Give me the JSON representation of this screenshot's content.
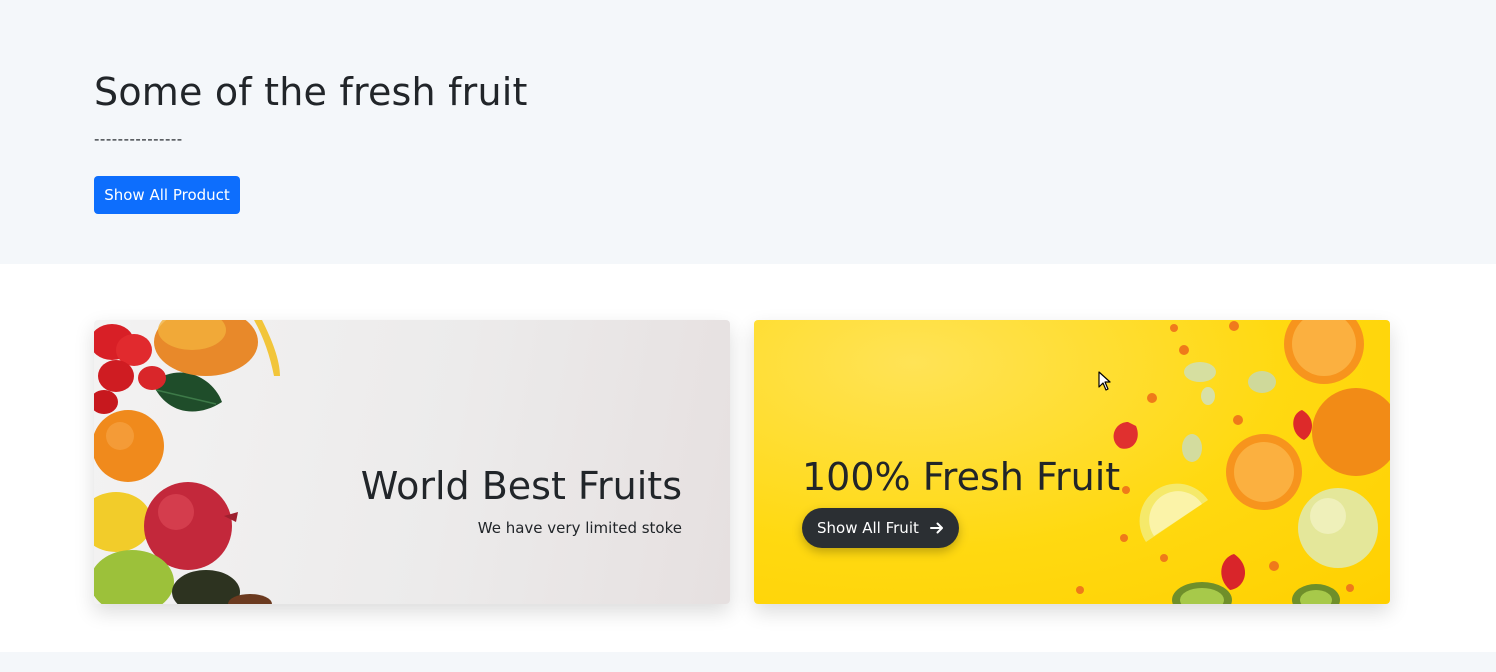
{
  "hero": {
    "title": "Some of the fresh fruit",
    "divider": "---------------",
    "button_label": "Show All Product"
  },
  "cards": {
    "left": {
      "title": "World Best Fruits",
      "subtitle": "We have very limited stoke"
    },
    "right": {
      "title": "100% Fresh Fruit",
      "button_label": "Show All Fruit",
      "button_icon": "arrow-right-icon"
    }
  },
  "colors": {
    "primary": "#0d6efd",
    "dark_button": "#2b2f33",
    "hero_bg": "#f4f7fa",
    "card_yellow": "#ffd911"
  }
}
